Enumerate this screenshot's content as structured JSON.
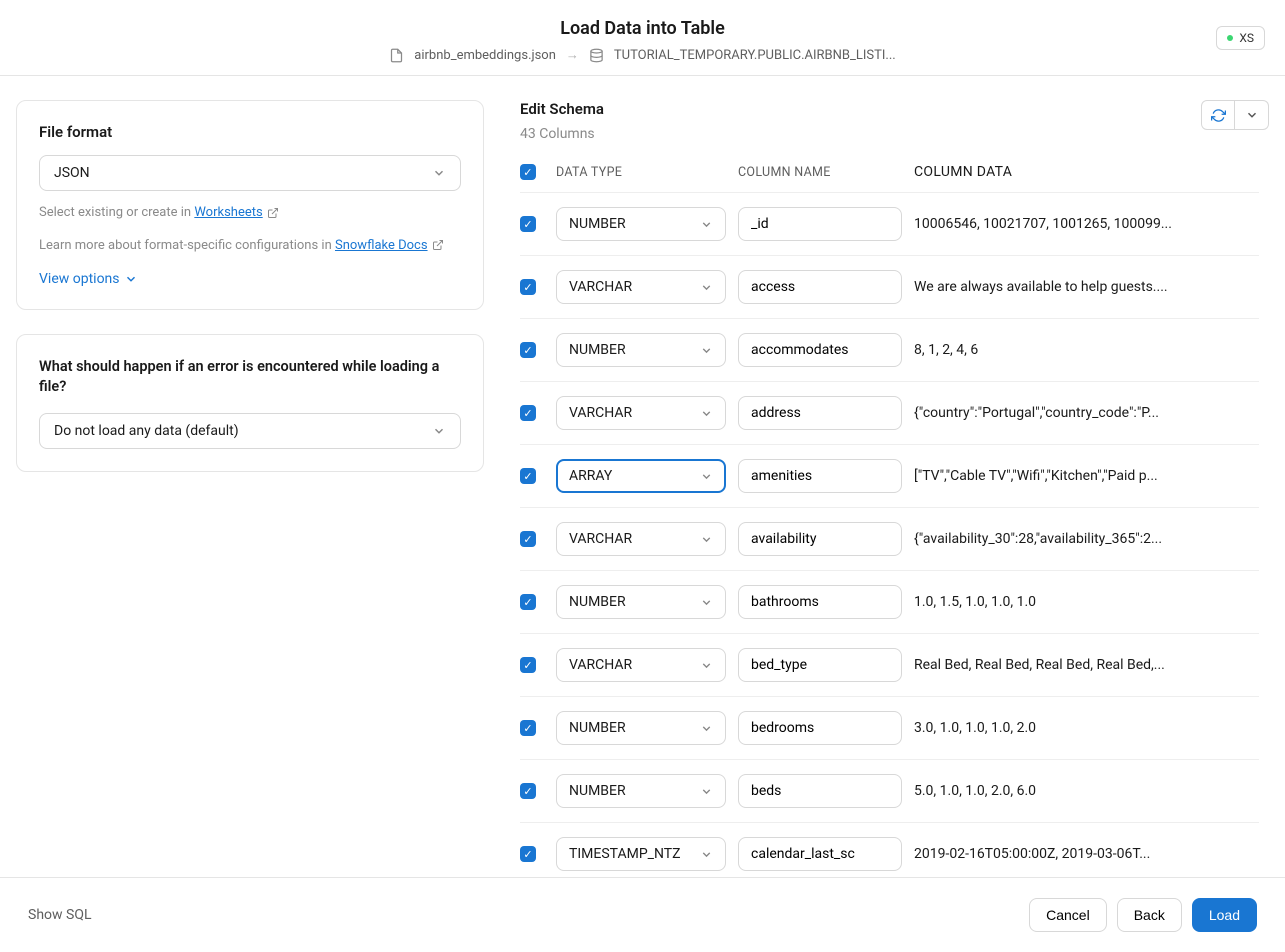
{
  "header": {
    "title": "Load Data into Table",
    "source_file": "airbnb_embeddings.json",
    "target": "TUTORIAL_TEMPORARY.PUBLIC.AIRBNB_LISTI...",
    "badge": "XS"
  },
  "left": {
    "file_format_label": "File format",
    "file_format_value": "JSON",
    "help1_prefix": "Select existing or create in ",
    "help1_link": "Worksheets",
    "help2_prefix": "Learn more about format-specific configurations in ",
    "help2_link": "Snowflake Docs",
    "view_options": "View options",
    "error_question": "What should happen if an error is encountered while loading a file?",
    "error_value": "Do not load any data (default)"
  },
  "schema": {
    "title": "Edit Schema",
    "subtitle": "43 Columns",
    "head_type": "DATA TYPE",
    "head_name": "COLUMN NAME",
    "head_data": "COLUMN DATA",
    "rows": [
      {
        "type": "NUMBER",
        "name": "_id",
        "data": "10006546, 10021707, 1001265, 100099...",
        "focused": false
      },
      {
        "type": "VARCHAR",
        "name": "access",
        "data": "We are always available to help guests....",
        "focused": false
      },
      {
        "type": "NUMBER",
        "name": "accommodates",
        "data": "8, 1, 2, 4, 6",
        "focused": false
      },
      {
        "type": "VARCHAR",
        "name": "address",
        "data": "{\"country\":\"Portugal\",\"country_code\":\"P...",
        "focused": false
      },
      {
        "type": "ARRAY",
        "name": "amenities",
        "data": "[\"TV\",\"Cable TV\",\"Wifi\",\"Kitchen\",\"Paid p...",
        "focused": true
      },
      {
        "type": "VARCHAR",
        "name": "availability",
        "data": "{\"availability_30\":28,\"availability_365\":2...",
        "focused": false
      },
      {
        "type": "NUMBER",
        "name": "bathrooms",
        "data": "1.0, 1.5, 1.0, 1.0, 1.0",
        "focused": false
      },
      {
        "type": "VARCHAR",
        "name": "bed_type",
        "data": "Real Bed, Real Bed, Real Bed, Real Bed,...",
        "focused": false
      },
      {
        "type": "NUMBER",
        "name": "bedrooms",
        "data": "3.0, 1.0, 1.0, 1.0, 2.0",
        "focused": false
      },
      {
        "type": "NUMBER",
        "name": "beds",
        "data": "5.0, 1.0, 1.0, 2.0, 6.0",
        "focused": false
      },
      {
        "type": "TIMESTAMP_NTZ",
        "name": "calendar_last_sc",
        "data": "2019-02-16T05:00:00Z, 2019-03-06T...",
        "focused": false
      }
    ]
  },
  "footer": {
    "show_sql": "Show SQL",
    "cancel": "Cancel",
    "back": "Back",
    "load": "Load"
  }
}
